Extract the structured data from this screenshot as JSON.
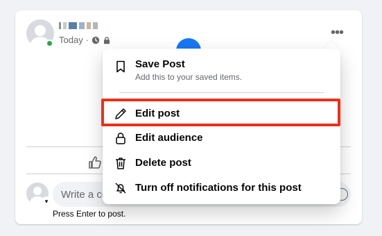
{
  "post": {
    "timestamp": "Today",
    "meta_separator": "·",
    "more_label": "•••"
  },
  "menu": {
    "items": [
      {
        "label": "Save Post",
        "sublabel": "Add this to your saved items.",
        "icon": "bookmark-icon"
      },
      {
        "label": "Edit post",
        "icon": "pencil-icon"
      },
      {
        "label": "Edit audience",
        "icon": "lock-icon"
      },
      {
        "label": "Delete post",
        "icon": "trash-icon"
      },
      {
        "label": "Turn off notifications for this post",
        "icon": "bell-off-icon"
      }
    ]
  },
  "comment": {
    "placeholder": "Write a comment…",
    "hint": "Press Enter to post."
  },
  "colors": {
    "highlight": "#e8321b",
    "online": "#31a24c",
    "accent": "#1877f2"
  }
}
